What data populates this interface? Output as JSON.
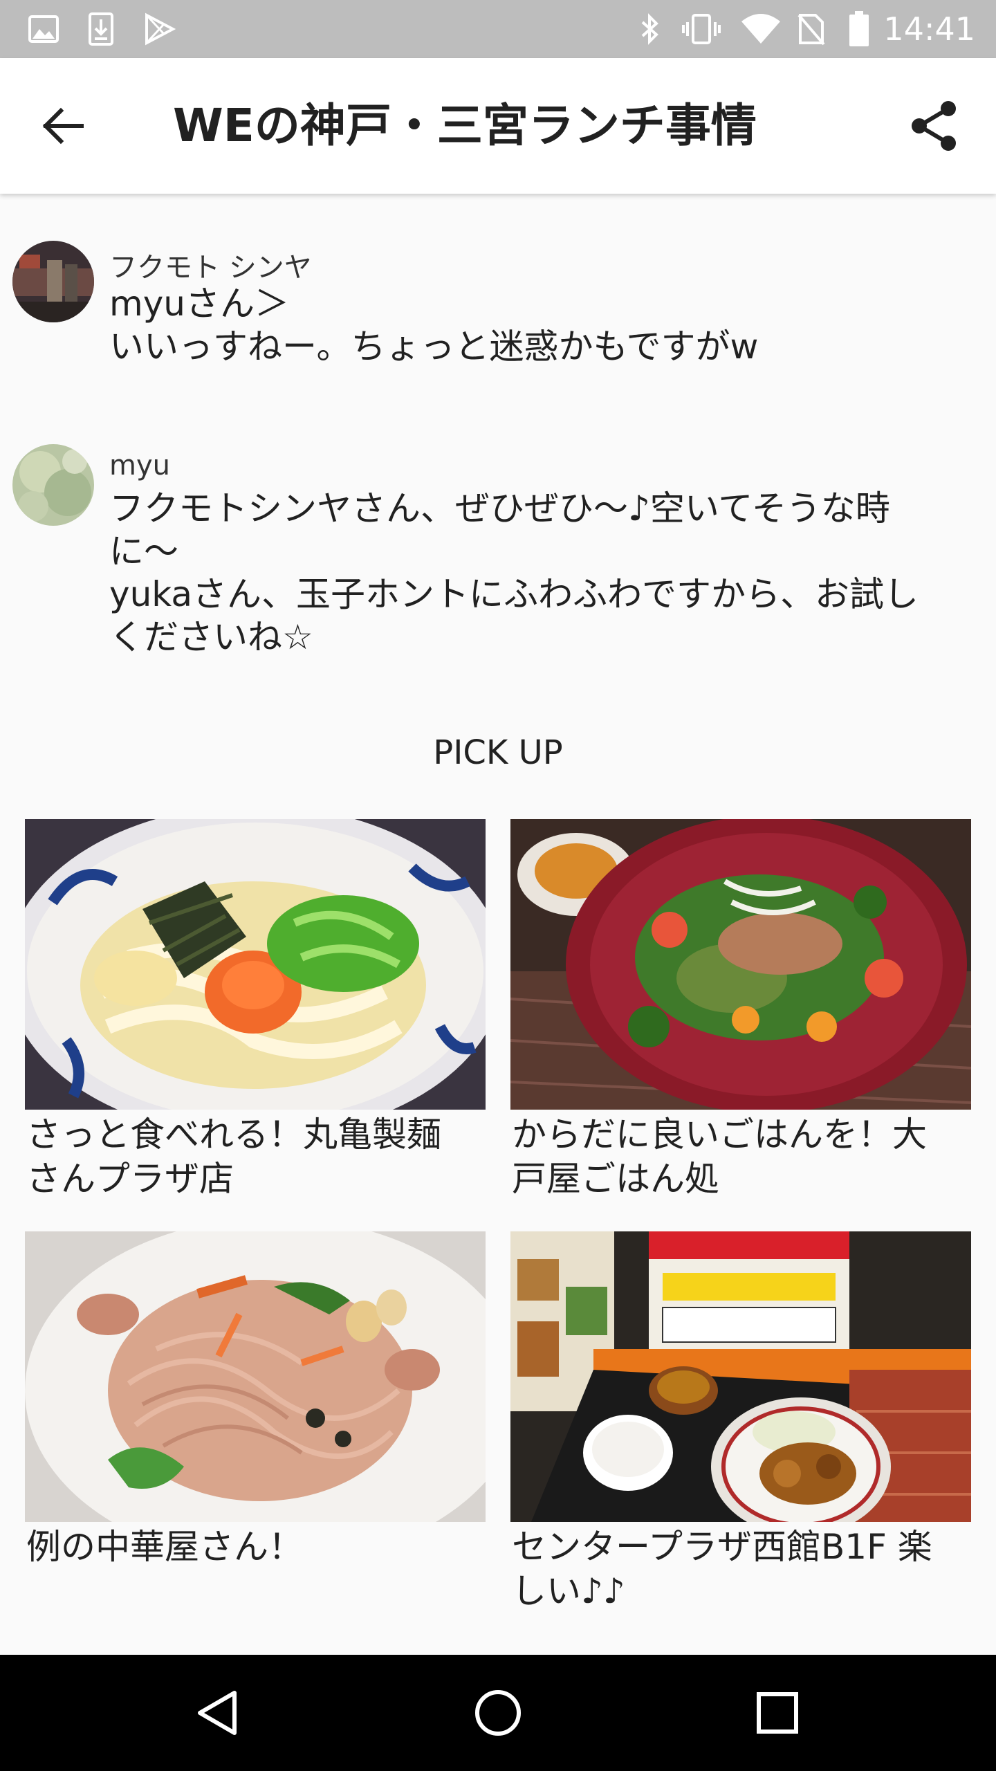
{
  "status_bar": {
    "time": "14:41",
    "left_icons": [
      "image-icon",
      "download-icon",
      "play-store-icon"
    ],
    "right_icons": [
      "bluetooth-icon",
      "vibrate-icon",
      "wifi-icon",
      "no-sim-icon",
      "battery-icon"
    ]
  },
  "app_bar": {
    "title": "WEの神戸・三宮ランチ事情",
    "back_icon": "arrow-back-icon",
    "share_icon": "share-icon"
  },
  "comments": [
    {
      "author": "フクモト シンヤ",
      "body": "myuさん＞\nいいっすねー。ちょっと迷惑かもですがw"
    },
    {
      "author": "myu",
      "body": "フクモトシンヤさん、ぜひぜひ〜♪空いてそうな時\nに〜\nyukaさん、玉子ホントにふわふわですから、お試し\nくださいね☆"
    }
  ],
  "pickup": {
    "title": "PICK UP",
    "items": [
      {
        "caption": "さっと食べれる！丸亀製麺\nさんプラザ店"
      },
      {
        "caption": "からだに良いごはんを！大\n戸屋ごはん処"
      },
      {
        "caption": "例の中華屋さん！"
      },
      {
        "caption": "センタープラザ西館B1F 楽\nしい♪♪"
      }
    ]
  },
  "nav_bar": {
    "icons": [
      "nav-back-icon",
      "nav-home-icon",
      "nav-recents-icon"
    ]
  }
}
